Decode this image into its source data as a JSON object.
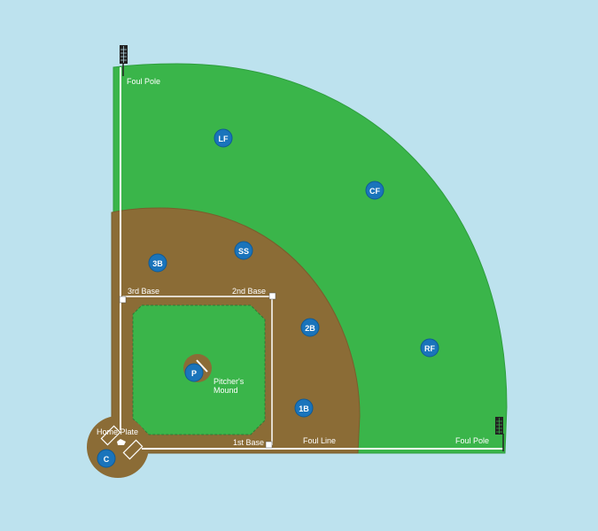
{
  "colors": {
    "background": "#bde2ee",
    "grass": "#3ab54a",
    "grass_edge": "#2e9e3e",
    "dirt": "#8b6c36",
    "dirt_edge": "#7a5d2c",
    "line": "#ffffff",
    "player": "#1a74bb",
    "player_edge": "#0f5a96"
  },
  "labels": {
    "foul_pole_left": "Foul Pole",
    "foul_pole_right": "Foul Pole",
    "foul_line": "Foul Line",
    "third_base": "3rd Base",
    "second_base": "2nd Base",
    "first_base": "1st Base",
    "home_plate": "Home Plate",
    "pitchers_mound_line1": "Pitcher's",
    "pitchers_mound_line2": "Mound"
  },
  "positions": {
    "lf": "LF",
    "cf": "CF",
    "rf": "RF",
    "ss": "SS",
    "third": "3B",
    "second": "2B",
    "first": "1B",
    "pitcher": "P",
    "catcher": "C"
  }
}
